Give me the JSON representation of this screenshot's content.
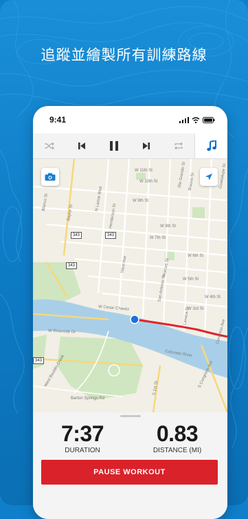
{
  "promo": {
    "headline": "追蹤並繪製所有訓練路線"
  },
  "status_bar": {
    "time": "9:41"
  },
  "media_controls": {
    "shuffle": "shuffle-icon",
    "previous": "previous-icon",
    "pause": "pause-icon",
    "next": "next-icon",
    "repeat": "repeat-icon",
    "music": "music-note-icon"
  },
  "map": {
    "streets": [
      "W 11th St",
      "W 10th St",
      "W 9th St",
      "W 7th St",
      "W 8th St",
      "W 6th St",
      "W 5th St",
      "W 4th St",
      "W 3rd St",
      "W Cesar Chavez",
      "W Riverside Dr",
      "Colorado River",
      "Barton Springs Rd",
      "S Congress Ave",
      "S 1st St",
      "Congress Ave",
      "Lavaca St",
      "San Antonio St",
      "Nueces St",
      "West Ave",
      "N Lamar Blvd",
      "Baylor St",
      "Henderson St",
      "Rio Grande St",
      "Guadalupe St",
      "Blanco St",
      "West Bouldin Creek",
      "Brazos St"
    ],
    "shields": [
      "343",
      "343",
      "343",
      "343"
    ]
  },
  "workout": {
    "duration_value": "7:37",
    "duration_label": "DURATION",
    "distance_value": "0.83",
    "distance_label": "DISTANCE (MI)",
    "pause_label": "PAUSE WORKOUT"
  },
  "colors": {
    "brand_blue": "#0d7ac4",
    "pause_red": "#d9222a",
    "route_red": "#e0242b",
    "location_blue": "#1f6fe0"
  }
}
